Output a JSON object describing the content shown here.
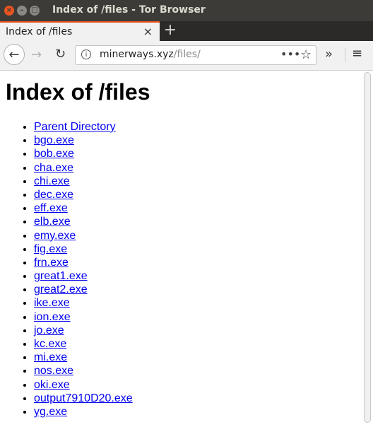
{
  "window": {
    "title": "Index of /files - Tor Browser"
  },
  "tab": {
    "label": "Index of /files",
    "close": "×"
  },
  "newtab": "+",
  "nav": {
    "back": "←",
    "forward": "→",
    "reload": "↻",
    "info": "i"
  },
  "url": {
    "domain": "minerways.xyz",
    "path": "/files/"
  },
  "urlbar": {
    "actions": "•••",
    "bookmark": "☆"
  },
  "toolbar": {
    "overflow": "»",
    "menu": "≡"
  },
  "page": {
    "heading": "Index of /files",
    "links": [
      "Parent Directory",
      "bgo.exe",
      "bob.exe",
      "cha.exe",
      "chi.exe",
      "dec.exe",
      "eff.exe",
      "elb.exe",
      "emy.exe",
      "fig.exe",
      "frn.exe",
      "great1.exe",
      "great2.exe",
      "ike.exe",
      "ion.exe",
      "jo.exe",
      "kc.exe",
      "mi.exe",
      "nos.exe",
      "oki.exe",
      "output7910D20.exe",
      "yg.exe"
    ]
  }
}
